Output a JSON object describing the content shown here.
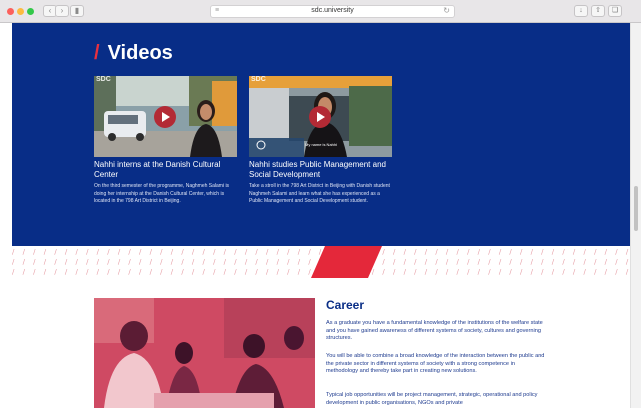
{
  "browser": {
    "url": "sdc.university"
  },
  "videos": {
    "title": "Videos",
    "cards": [
      {
        "badge": "SDC",
        "title": "Nahhi interns at the Danish Cultural Center",
        "description": "On the third semester of the programme, Naghmeh Salami is doing her internship at the Danish Cultural Center, which is located in the 798 Art District in Beijing."
      },
      {
        "badge": "SDC",
        "caption": "My name is Nahhi",
        "title": "Nahhi studies Public Management and Social Development",
        "description": "Take a stroll in the 798 Art District in Beijing with Danish student Naghmeh Salami and learn what she has experienced as a Public Management and Social Development student."
      }
    ]
  },
  "career": {
    "title": "Career",
    "paragraphs": [
      "As a graduate you have a fundamental knowledge of the institutions of the welfare state and you have gained awareness of different systems of society, cultures and governing structures.",
      "You will be able to combine a broad knowledge of the interaction between the public and the private sector in different systems of society with a strong competence in methodology and thereby take part in creating new solutions.",
      "Typical job opportunities will be project management, strategic, operational and policy development in public organisations, NGOs and private"
    ]
  },
  "colors": {
    "navy": "#082d87",
    "accent_red": "#e8303f",
    "play_button": "#b32a35"
  }
}
